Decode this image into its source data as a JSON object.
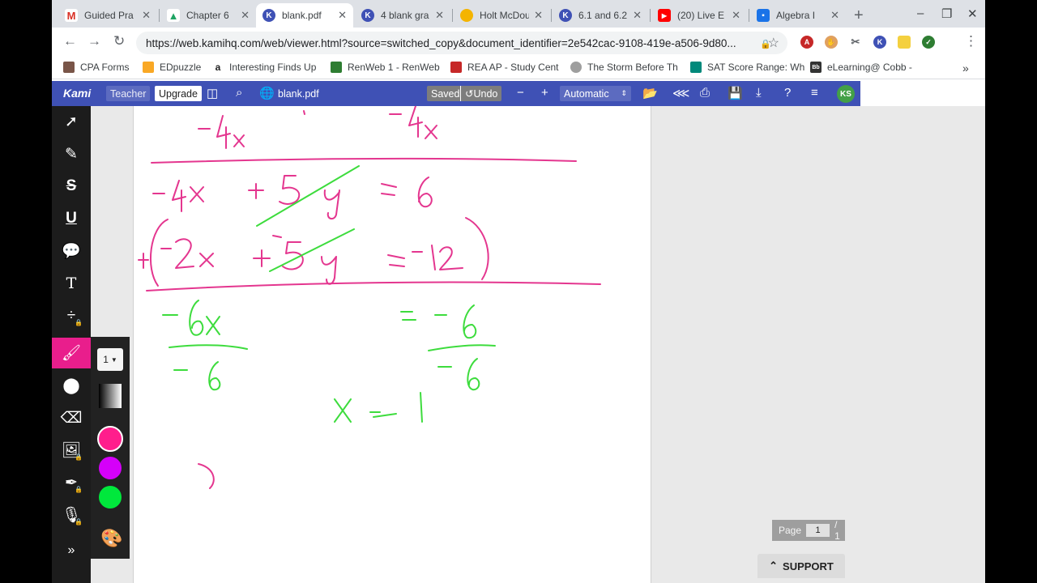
{
  "tabs": [
    {
      "title": "Guided Pra",
      "icon": "gmail-icon",
      "color": "#d93025",
      "glyph": "M"
    },
    {
      "title": "Chapter 6",
      "icon": "drive-icon",
      "color": "#1fa463",
      "glyph": "▲"
    },
    {
      "title": "blank.pdf",
      "icon": "kami-icon",
      "color": "#3f51b5",
      "glyph": "K",
      "active": true
    },
    {
      "title": "4 blank gra",
      "icon": "kami-icon",
      "color": "#3f51b5",
      "glyph": "K"
    },
    {
      "title": "Holt McDou",
      "icon": "holt-icon",
      "color": "#f4b400",
      "glyph": ""
    },
    {
      "title": "6.1 and 6.2",
      "icon": "kami-icon",
      "color": "#3f51b5",
      "glyph": "K"
    },
    {
      "title": "(20) Live E",
      "icon": "youtube-icon",
      "color": "#ff0000",
      "glyph": "▶"
    },
    {
      "title": "Algebra I",
      "icon": "classroom-icon",
      "color": "#1a73e8",
      "glyph": "▪"
    }
  ],
  "url": "https://web.kamihq.com/web/viewer.html?source=switched_copy&document_identifier=2e542cac-9108-419e-a506-9d80...",
  "bookmarks": [
    {
      "label": "CPA Forms",
      "color": "#795548"
    },
    {
      "label": "EDpuzzle",
      "color": "#f9a825"
    },
    {
      "label": "Interesting Finds Up",
      "color": "#222222"
    },
    {
      "label": "RenWeb 1 - RenWeb",
      "color": "#2e7d32"
    },
    {
      "label": "REA AP - Study Cent",
      "color": "#c62828"
    },
    {
      "label": "The Storm Before Th",
      "color": "#9e9e9e"
    },
    {
      "label": "SAT Score Range: Wh",
      "color": "#00897b"
    },
    {
      "label": "eLearning@ Cobb -",
      "color": "#333333"
    }
  ],
  "kami": {
    "logo": "Kami",
    "teacher": "Teacher",
    "upgrade": "Upgrade",
    "doc_name": "blank.pdf",
    "saved": "Saved",
    "undo": "Undo",
    "zoom": "Automatic",
    "avatar": "KS"
  },
  "tool_panel": {
    "thickness": "1",
    "colors": [
      "#ff1e8c",
      "#d500f9",
      "#00e83c"
    ]
  },
  "pager": {
    "label": "Page",
    "current": "1",
    "total": "/ 1"
  },
  "support": "SUPPORT",
  "ink": {
    "magenta": "#e4368f",
    "green": "#3ddc3d"
  }
}
